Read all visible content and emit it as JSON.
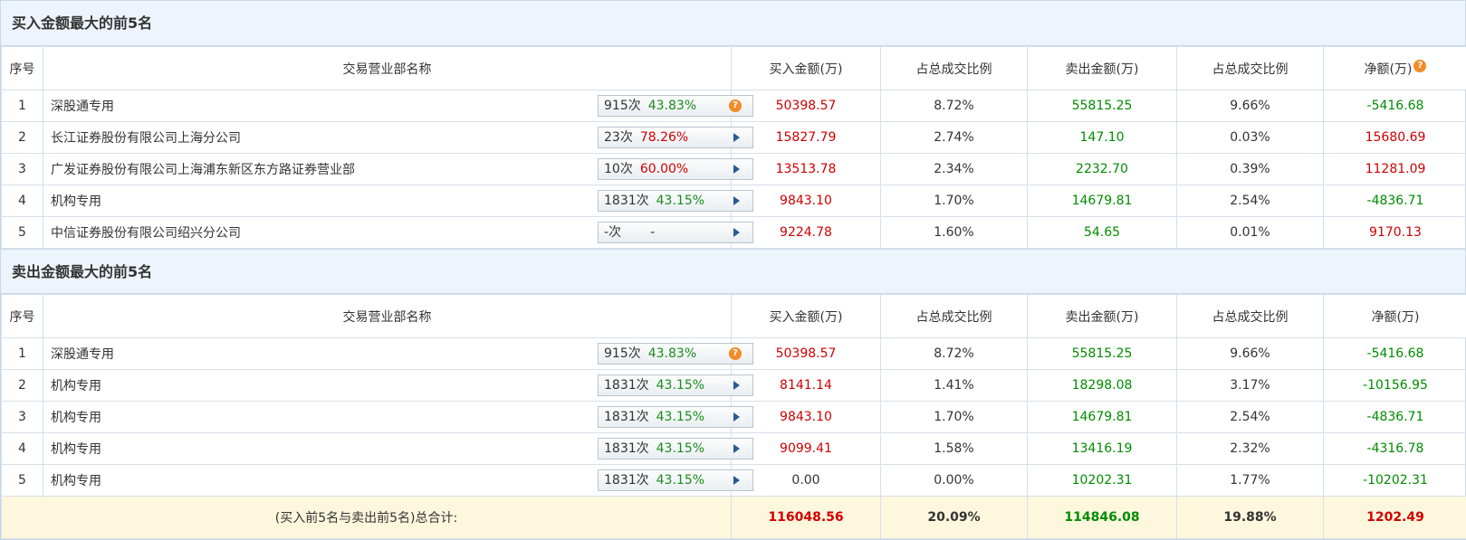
{
  "buy_section": {
    "title": "买入金额最大的前5名",
    "headers": {
      "idx": "序号",
      "name": "交易营业部名称",
      "buy": "买入金额(万)",
      "buy_pct": "占总成交比例",
      "sell": "卖出金额(万)",
      "sell_pct": "占总成交比例",
      "net": "净额(万)"
    },
    "rows": [
      {
        "idx": "1",
        "name": "深股通专用",
        "count": "915次",
        "rate": "43.83%",
        "buy": "50398.57",
        "buy_pct": "8.72%",
        "sell": "55815.25",
        "sell_pct": "9.66%",
        "net": "-5416.68"
      },
      {
        "idx": "2",
        "name": "长江证券股份有限公司上海分公司",
        "count": "23次",
        "rate": "78.26%",
        "buy": "15827.79",
        "buy_pct": "2.74%",
        "sell": "147.10",
        "sell_pct": "0.03%",
        "net": "15680.69"
      },
      {
        "idx": "3",
        "name": "广发证券股份有限公司上海浦东新区东方路证券营业部",
        "count": "10次",
        "rate": "60.00%",
        "buy": "13513.78",
        "buy_pct": "2.34%",
        "sell": "2232.70",
        "sell_pct": "0.39%",
        "net": "11281.09"
      },
      {
        "idx": "4",
        "name": "机构专用",
        "count": "1831次",
        "rate": "43.15%",
        "buy": "9843.10",
        "buy_pct": "1.70%",
        "sell": "14679.81",
        "sell_pct": "2.54%",
        "net": "-4836.71"
      },
      {
        "idx": "5",
        "name": "中信证券股份有限公司绍兴分公司",
        "count": "-次",
        "rate": "-",
        "buy": "9224.78",
        "buy_pct": "1.60%",
        "sell": "54.65",
        "sell_pct": "0.01%",
        "net": "9170.13"
      }
    ]
  },
  "sell_section": {
    "title": "卖出金额最大的前5名",
    "headers": {
      "idx": "序号",
      "name": "交易营业部名称",
      "buy": "买入金额(万)",
      "buy_pct": "占总成交比例",
      "sell": "卖出金额(万)",
      "sell_pct": "占总成交比例",
      "net": "净额(万)"
    },
    "rows": [
      {
        "idx": "1",
        "name": "深股通专用",
        "count": "915次",
        "rate": "43.83%",
        "buy": "50398.57",
        "buy_pct": "8.72%",
        "sell": "55815.25",
        "sell_pct": "9.66%",
        "net": "-5416.68"
      },
      {
        "idx": "2",
        "name": "机构专用",
        "count": "1831次",
        "rate": "43.15%",
        "buy": "8141.14",
        "buy_pct": "1.41%",
        "sell": "18298.08",
        "sell_pct": "3.17%",
        "net": "-10156.95"
      },
      {
        "idx": "3",
        "name": "机构专用",
        "count": "1831次",
        "rate": "43.15%",
        "buy": "9843.10",
        "buy_pct": "1.70%",
        "sell": "14679.81",
        "sell_pct": "2.54%",
        "net": "-4836.71"
      },
      {
        "idx": "4",
        "name": "机构专用",
        "count": "1831次",
        "rate": "43.15%",
        "buy": "9099.41",
        "buy_pct": "1.58%",
        "sell": "13416.19",
        "sell_pct": "2.32%",
        "net": "-4316.78"
      },
      {
        "idx": "5",
        "name": "机构专用",
        "count": "1831次",
        "rate": "43.15%",
        "buy": "0.00",
        "buy_pct": "0.00%",
        "sell": "10202.31",
        "sell_pct": "1.77%",
        "net": "-10202.31"
      }
    ]
  },
  "total": {
    "label": "(买入前5名与卖出前5名)总合计:",
    "buy": "116048.56",
    "buy_pct": "20.09%",
    "sell": "114846.08",
    "sell_pct": "19.88%",
    "net": "1202.49"
  },
  "icons": {
    "help": "question-circle-icon",
    "expand": "triangle-right-icon"
  },
  "colors": {
    "positive": "#d00000",
    "negative": "#008c00",
    "rate": "#1a8c1a",
    "help_icon": "#f28c28",
    "header_bg": "#eef4fb",
    "total_bg": "#fdf7dd"
  }
}
